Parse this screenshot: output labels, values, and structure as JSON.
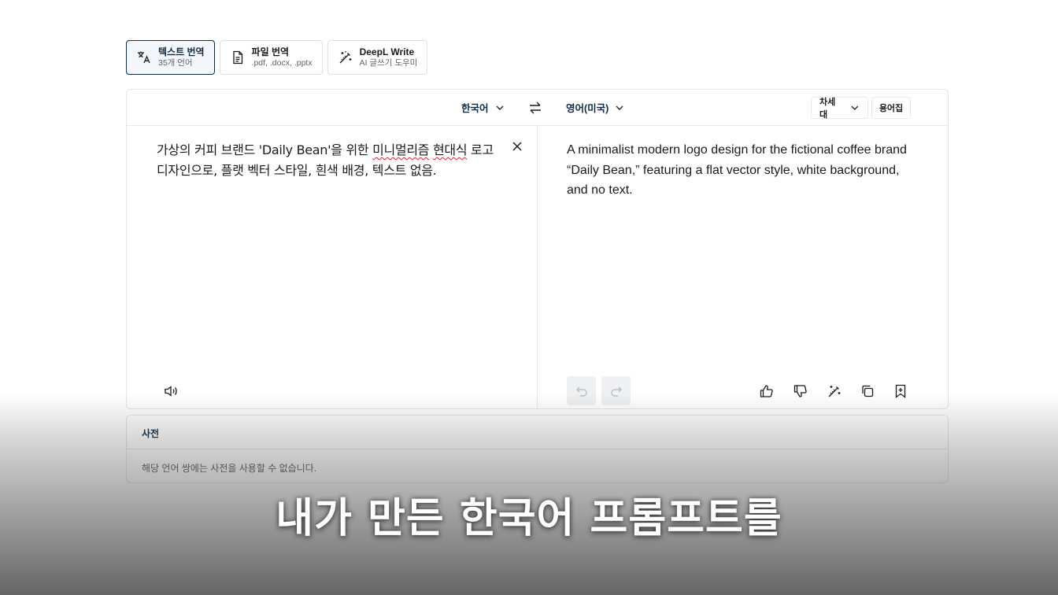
{
  "mode_tabs": [
    {
      "title": "텍스트 번역",
      "subtitle": "35개 언어",
      "icon": "translate-icon",
      "active": true
    },
    {
      "title": "파일 번역",
      "subtitle": ".pdf, .docx, .pptx",
      "icon": "document-icon",
      "active": false
    },
    {
      "title": "DeepL Write",
      "subtitle": "AI 글쓰기 도우미",
      "icon": "magic-wand-icon",
      "active": false
    }
  ],
  "translator": {
    "source_lang": "한국어",
    "target_lang": "영어(미국)",
    "model_select": "차세대",
    "glossary_button": "용어집",
    "source_text_part1": "가상의 커피 브랜드 'Daily Bean'을 위한 ",
    "source_text_mis1": "미니멀리즘",
    "source_text_space": " ",
    "source_text_mis2": "현대식",
    "source_text_part2": " 로고 디자인으로, 플랫 벡터 스타일, 흰색 배경, 텍스트 없음.",
    "target_text": "A minimalist modern logo design for the fictional coffee brand “Daily Bean,” featuring a flat vector style, white background, and no text."
  },
  "dictionary": {
    "title": "사전",
    "message": "해당 언어 쌍에는 사전을 사용할 수 없습니다."
  },
  "subtitle": "내가 만든 한국어 프롬프트를",
  "colors": {
    "accent": "#0f2b46",
    "border": "#e3e6ea",
    "muted_text": "#5b6570",
    "spellcheck": "#dd2233"
  }
}
